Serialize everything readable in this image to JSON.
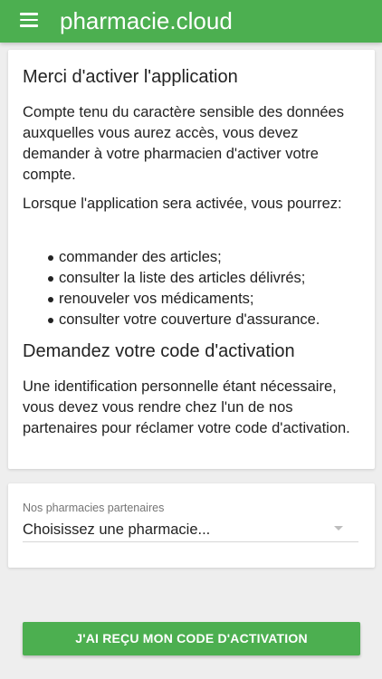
{
  "header": {
    "app_title": "pharmacie.cloud",
    "menu_icon": "hamburger-menu-icon",
    "background_color": "#4caf50"
  },
  "info": {
    "activate_heading": "Merci d'activer l'application",
    "activate_paragraph": "Compte tenu du caractère sensible des données auxquelles vous aurez accès, vous devez demander à votre pharmacien d'activer votre compte.",
    "features_intro": "Lorsque l'application sera activée, vous pourrez:",
    "features": [
      "commander des articles;",
      "consulter la liste des articles délivrés;",
      "renouveler vos médicaments;",
      "consulter votre couverture d'assurance."
    ],
    "code_heading": "Demandez votre code d'activation",
    "code_paragraph": "Une identification personnelle étant nécessaire, vous devez vous rendre chez l'un de nos partenaires pour réclamer votre code d'activation."
  },
  "pharmacy_select": {
    "label": "Nos pharmacies partenaires",
    "selected_value": "Choisissez une pharmacie...",
    "caret_icon": "dropdown-caret-icon"
  },
  "actions": {
    "received_code_label": "J'AI REÇU MON CODE D'ACTIVATION",
    "accent_color": "#4caf50"
  }
}
